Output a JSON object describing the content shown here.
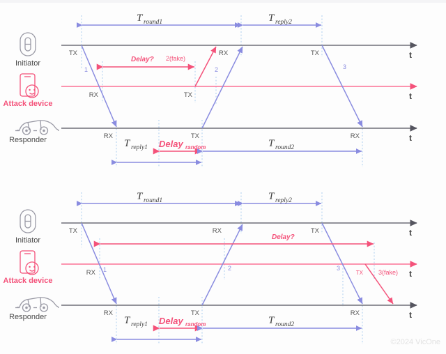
{
  "meta": {
    "copyright": "©2024 VicOne",
    "colors": {
      "blue": "#8a8ce0",
      "red": "#f4527a",
      "axis_gray": "#6e6e78",
      "guide": "#aacdf0"
    }
  },
  "roles": {
    "initiator": "Initiator",
    "attack": "Attack device",
    "responder": "Responder",
    "time_axis": "t"
  },
  "icons": {
    "initiator": "key-fob-icon",
    "attack": "phone-smiley-icon",
    "responder": "car-icon"
  },
  "diagrams": [
    {
      "id": "top",
      "name": "relay-attack-fake-response",
      "spans": [
        {
          "name": "t-round1",
          "var": "T",
          "sub": "round1"
        },
        {
          "name": "t-reply2",
          "var": "T",
          "sub": "reply2"
        },
        {
          "name": "t-reply1",
          "var": "T",
          "sub": "reply1"
        },
        {
          "name": "t-round2",
          "var": "T",
          "sub": "round2"
        },
        {
          "name": "delay-random",
          "var": "Delay",
          "sub": "random"
        },
        {
          "name": "delay-question",
          "label": "Delay?"
        }
      ],
      "markers": {
        "initiator": [
          "TX",
          "RX",
          "TX"
        ],
        "attack": [
          "RX",
          "TX"
        ],
        "responder": [
          "RX",
          "TX",
          "RX"
        ]
      },
      "messages": [
        "1",
        "2(fake)",
        "2",
        "3"
      ]
    },
    {
      "id": "bottom",
      "name": "relay-attack-fake-final",
      "spans": [
        {
          "name": "t-round1",
          "var": "T",
          "sub": "round1"
        },
        {
          "name": "t-reply2",
          "var": "T",
          "sub": "reply2"
        },
        {
          "name": "t-reply1",
          "var": "T",
          "sub": "reply1"
        },
        {
          "name": "t-round2",
          "var": "T",
          "sub": "round2"
        },
        {
          "name": "delay-random",
          "var": "Delay",
          "sub": "random"
        },
        {
          "name": "delay-question",
          "label": "Delay?"
        }
      ],
      "markers": {
        "initiator": [
          "TX",
          "RX",
          "TX"
        ],
        "attack": [
          "RX",
          "TX"
        ],
        "responder": [
          "RX",
          "TX",
          "RX"
        ]
      },
      "messages": [
        "1",
        "2",
        "3",
        "3(fake)"
      ]
    }
  ],
  "labels": {
    "tx": "TX",
    "rx": "RX",
    "msg1": "1",
    "msg2": "2",
    "msg3": "3",
    "msg2_fake": "2(fake)",
    "msg3_fake": "3(fake)",
    "delay_q": "Delay?",
    "delay_var": "Delay",
    "delay_sub": "random",
    "T": "T",
    "sub_round1": "round1",
    "sub_round2": "round2",
    "sub_reply1": "reply1",
    "sub_reply2": "reply2"
  }
}
